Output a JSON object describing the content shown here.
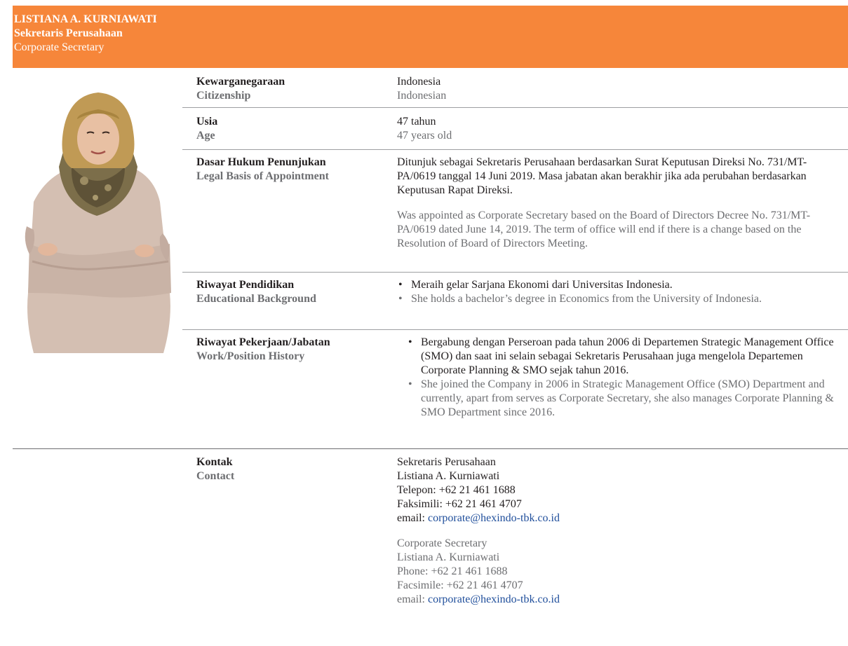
{
  "header": {
    "name": "LISTIANA A. KURNIAWATI",
    "role_id": "Sekretaris Perusahaan",
    "role_en": "Corporate Secretary",
    "bg_color": "#f6863a"
  },
  "rows": {
    "citizenship": {
      "label_id": "Kewarganegaraan",
      "label_en": "Citizenship",
      "value_id": "Indonesia",
      "value_en": "Indonesian"
    },
    "age": {
      "label_id": "Usia",
      "label_en": "Age",
      "value_id": "47 tahun",
      "value_en": "47 years old"
    },
    "legal": {
      "label_id": "Dasar Hukum Penunjukan",
      "label_en": "Legal Basis of Appointment",
      "value_id": "Ditunjuk sebagai Sekretaris Perusahaan berdasarkan Surat  Keputusan Direksi No. 731/MT-PA/0619 tanggal 14 Juni 2019. Masa jabatan akan berakhir jika ada perubahan berdasarkan Keputusan Rapat Direksi.",
      "value_en": "Was appointed as Corporate Secretary based on the Board of Directors Decree No. 731/MT-PA/0619 dated June 14, 2019. The term of office will end if there is a change based on the Resolution of Board of Directors Meeting."
    },
    "education": {
      "label_id": "Riwayat Pendidikan",
      "label_en": "Educational Background",
      "value_id": "Meraih gelar Sarjana Ekonomi dari Universitas Indonesia.",
      "value_en": "She holds a bachelor’s degree in Economics from the University of Indonesia."
    },
    "work": {
      "label_id": "Riwayat Pekerjaan/Jabatan",
      "label_en": "Work/Position History",
      "value_id": "Bergabung dengan Perseroan pada tahun 2006 di Departemen Strategic Management Office (SMO) dan saat ini selain sebagai Sekretaris Perusahaan juga mengelola Departemen Corporate Planning & SMO sejak tahun 2016.",
      "value_en": "She joined the Company in 2006 in Strategic Management Office (SMO) Department and currently, apart from serves as Corporate Secretary, she also manages Corporate Planning & SMO Department since 2016."
    },
    "contact": {
      "label_id": "Kontak",
      "label_en": "Contact",
      "id": {
        "title": "Sekretaris Perusahaan",
        "name": "Listiana A. Kurniawati",
        "phone": "Telepon: +62 21 461 1688",
        "fax": "Faksimili: +62 21 461 4707",
        "email_label": "email: ",
        "email": "corporate@hexindo-tbk.co.id"
      },
      "en": {
        "title": "Corporate Secretary",
        "name": "Listiana A. Kurniawati",
        "phone": "Phone: +62 21 461 1688",
        "fax": "Facsimile: +62 21 461 4707",
        "email_label": "email: ",
        "email": "corporate@hexindo-tbk.co.id"
      }
    }
  }
}
